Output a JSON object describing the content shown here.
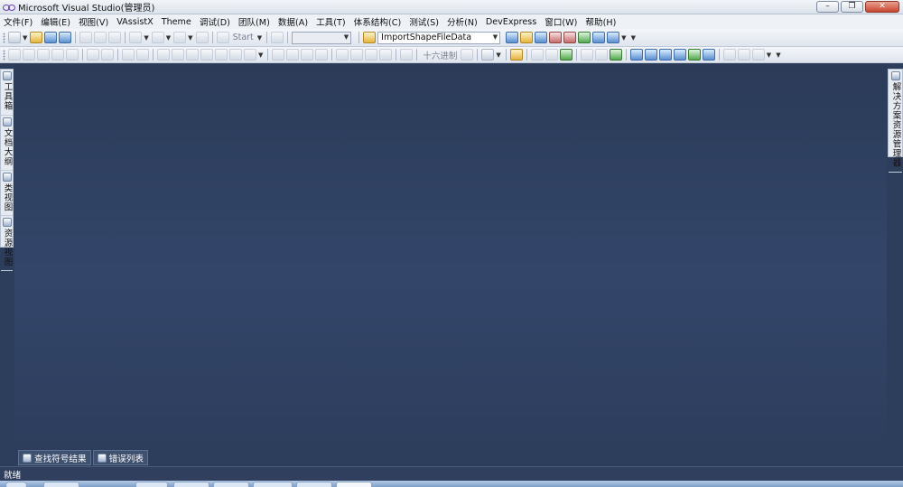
{
  "window": {
    "title": "Microsoft Visual Studio(管理员)",
    "minimize_glyph": "–",
    "restore_glyph": "❐",
    "close_glyph": "✕"
  },
  "menu": {
    "items": [
      "文件(F)",
      "编辑(E)",
      "视图(V)",
      "VAssistX",
      "Theme",
      "调试(D)",
      "团队(M)",
      "数据(A)",
      "工具(T)",
      "体系结构(C)",
      "测试(S)",
      "分析(N)",
      "DevExpress",
      "窗口(W)",
      "帮助(H)"
    ]
  },
  "toolbar": {
    "start_label": "Start",
    "config_value": "",
    "find_value": "ImportShapeFileData",
    "hex_label": "十六进制"
  },
  "side_left": {
    "tabs": [
      {
        "label": "工具箱",
        "icon": "toolbox-icon"
      },
      {
        "label": "文档大纲",
        "icon": "document-outline-icon"
      },
      {
        "label": "类视图",
        "icon": "class-view-icon"
      },
      {
        "label": "资源视图",
        "icon": "resource-view-icon"
      }
    ]
  },
  "side_right": {
    "tabs": [
      {
        "label": "解决方案资源管理器",
        "icon": "solution-explorer-icon"
      }
    ]
  },
  "bottom_tabs": {
    "items": [
      {
        "label": "查找符号结果",
        "icon": "find-symbol-results-icon"
      },
      {
        "label": "错误列表",
        "icon": "error-list-icon"
      }
    ]
  },
  "status": {
    "text": "就绪"
  },
  "colors": {
    "workspace": "#2d3e5c",
    "chrome": "#eef1f6"
  }
}
